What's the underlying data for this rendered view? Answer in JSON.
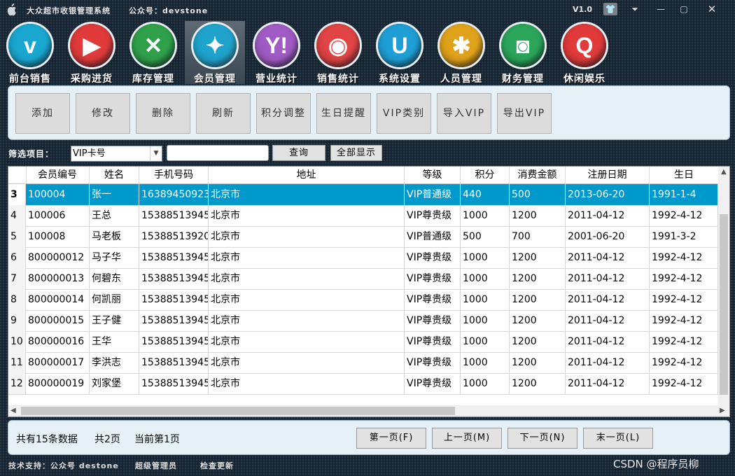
{
  "window": {
    "title": "大众超市收银管理系统",
    "wechat": "公众号：devstone",
    "version": "V1.0",
    "controls": {
      "skin": "👕",
      "menu": "⏷",
      "min": "—",
      "max": "▢",
      "close": "✕"
    }
  },
  "modules": [
    {
      "label": "前台销售",
      "glyph": "v",
      "color": "#19a7d0"
    },
    {
      "label": "采购进货",
      "glyph": "▶",
      "color": "#e03a3a"
    },
    {
      "label": "库存管理",
      "glyph": "✕",
      "color": "#2fa04a"
    },
    {
      "label": "会员管理",
      "glyph": "✦",
      "color": "#1fa3cc"
    },
    {
      "label": "营业统计",
      "glyph": "Y!",
      "color": "#a05bc4"
    },
    {
      "label": "销售统计",
      "glyph": "◉",
      "color": "#e04444"
    },
    {
      "label": "系统设置",
      "glyph": "U",
      "color": "#1f9fd6"
    },
    {
      "label": "人员管理",
      "glyph": "✱",
      "color": "#e0a21a"
    },
    {
      "label": "财务管理",
      "glyph": "◙",
      "color": "#2aa55a"
    },
    {
      "label": "休闲娱乐",
      "glyph": "Q",
      "color": "#e03a3a"
    }
  ],
  "actions": [
    "添加",
    "修改",
    "删除",
    "刷新",
    "积分调整",
    "生日提醒",
    "VIP类别",
    "导入VIP",
    "导出VIP"
  ],
  "filter": {
    "label": "筛选项目：",
    "selected": "VIP卡号",
    "query": "查询",
    "show_all": "全部显示"
  },
  "table": {
    "headers": [
      "会员编号",
      "姓名",
      "手机号码",
      "地址",
      "等级",
      "积分",
      "消费金额",
      "注册日期",
      "生日"
    ],
    "rows": [
      {
        "n": "3",
        "cells": [
          "100004",
          "张一",
          "16389450923",
          "北京市",
          "VIP普通级",
          "440",
          "500",
          "2013-06-20",
          "1991-1-4"
        ]
      },
      {
        "n": "4",
        "cells": [
          "100006",
          "王总",
          "15388513945",
          "北京市",
          "VIP尊贵级",
          "1000",
          "1200",
          "2011-04-12",
          "1992-4-12"
        ]
      },
      {
        "n": "5",
        "cells": [
          "100008",
          "马老板",
          "15388513920",
          "北京市",
          "VIP普通级",
          "500",
          "700",
          "2001-06-20",
          "1991-3-2"
        ]
      },
      {
        "n": "6",
        "cells": [
          "800000012",
          "马子华",
          "15388513945",
          "北京市",
          "VIP尊贵级",
          "1000",
          "1200",
          "2011-04-12",
          "1992-4-12"
        ]
      },
      {
        "n": "7",
        "cells": [
          "800000013",
          "何碧东",
          "15388513945",
          "北京市",
          "VIP尊贵级",
          "1000",
          "1200",
          "2011-04-12",
          "1992-4-12"
        ]
      },
      {
        "n": "8",
        "cells": [
          "800000014",
          "何凯丽",
          "15388513945",
          "北京市",
          "VIP尊贵级",
          "1000",
          "1200",
          "2011-04-12",
          "1992-4-12"
        ]
      },
      {
        "n": "9",
        "cells": [
          "800000015",
          "王子健",
          "15388513945",
          "北京市",
          "VIP尊贵级",
          "1000",
          "1200",
          "2011-04-12",
          "1992-4-12"
        ]
      },
      {
        "n": "10",
        "cells": [
          "800000016",
          "王华",
          "15388513945",
          "北京市",
          "VIP尊贵级",
          "1000",
          "1200",
          "2011-04-12",
          "1992-4-12"
        ]
      },
      {
        "n": "11",
        "cells": [
          "800000017",
          "李洪志",
          "15388513945",
          "北京市",
          "VIP尊贵级",
          "1000",
          "1200",
          "2011-04-12",
          "1992-4-12"
        ]
      },
      {
        "n": "12",
        "cells": [
          "800000019",
          "刘家堡",
          "15388513945",
          "北京市",
          "VIP尊贵级",
          "1000",
          "1200",
          "2011-04-12",
          "1992-4-12"
        ]
      }
    ]
  },
  "pager": {
    "total": "共有15条数据",
    "pages": "共2页",
    "current": "当前第1页",
    "first": "第一页(F)",
    "prev": "上一页(M)",
    "next": "下一页(N)",
    "last": "末一页(L)"
  },
  "status": {
    "support": "技术支持：公众号 destone",
    "user": "超级管理员",
    "update": "检查更新"
  },
  "watermark": "CSDN @程序员柳"
}
